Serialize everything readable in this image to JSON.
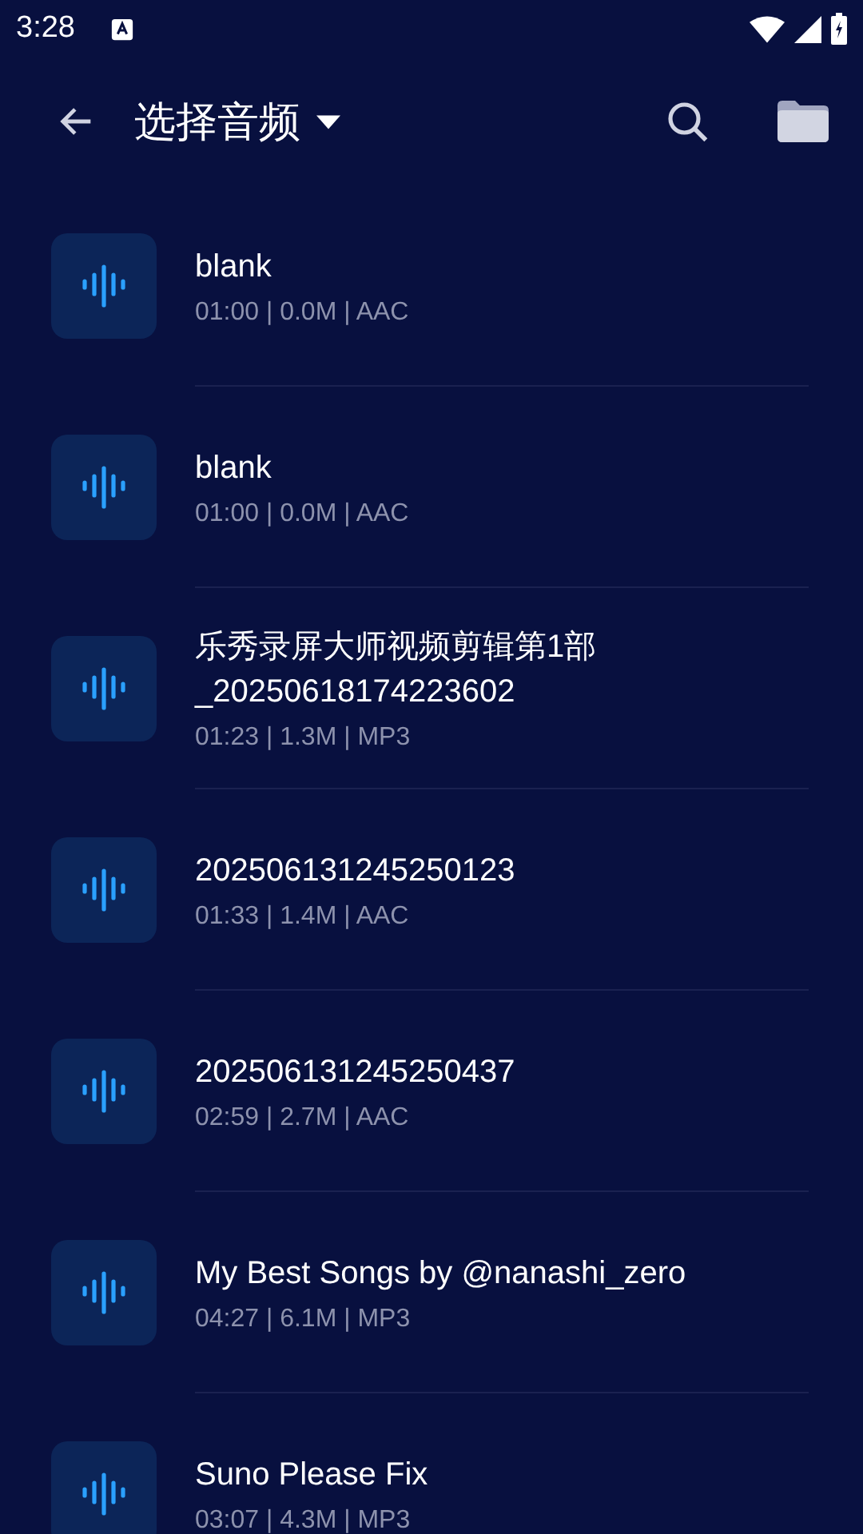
{
  "status_bar": {
    "time": "3:28"
  },
  "toolbar": {
    "title": "选择音频"
  },
  "files": [
    {
      "name": "blank",
      "meta": "01:00 | 0.0M | AAC"
    },
    {
      "name": "blank",
      "meta": "01:00 | 0.0M | AAC"
    },
    {
      "name": "乐秀录屏大师视频剪辑第1部_20250618174223602",
      "meta": "01:23 | 1.3M | MP3"
    },
    {
      "name": "202506131245250123",
      "meta": "01:33 | 1.4M | AAC"
    },
    {
      "name": "202506131245250437",
      "meta": "02:59 | 2.7M | AAC"
    },
    {
      "name": "My Best Songs by @nanashi_zero",
      "meta": "04:27 | 6.1M | MP3"
    },
    {
      "name": "Suno Please Fix",
      "meta": "03:07 | 4.3M | MP3"
    }
  ]
}
